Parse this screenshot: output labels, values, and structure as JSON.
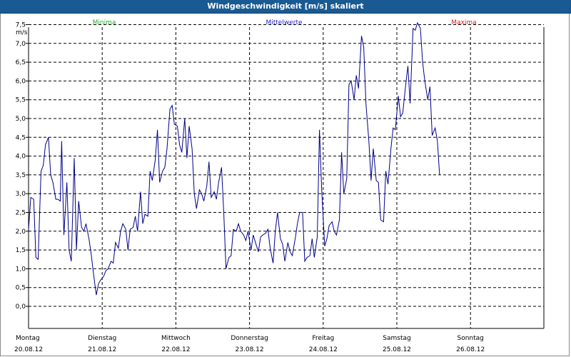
{
  "window": {
    "title": "Windgeschwindigkeit [m/s] skaliert"
  },
  "legend": {
    "min_label": "Minima",
    "min_color": "#22aa22",
    "mean_label": "Mittelwerte",
    "mean_color": "#2222cc",
    "max_label": "Maxima",
    "max_color": "#cc2222"
  },
  "chart_data": {
    "type": "line",
    "title": "Windgeschwindigkeit [m/s] skaliert",
    "ylabel": "m/s",
    "ylim": [
      0,
      7.5
    ],
    "yticks": [
      0.0,
      0.5,
      1.0,
      1.5,
      2.0,
      2.5,
      3.0,
      3.5,
      4.0,
      4.5,
      5.0,
      5.5,
      6.0,
      6.5,
      7.0,
      7.5
    ],
    "ytick_labels": [
      "0,0",
      "0,5",
      "1,0",
      "1,5",
      "2,0",
      "2,5",
      "3,0",
      "3,5",
      "4,0",
      "4,5",
      "5,0",
      "5,5",
      "6,0",
      "6,5",
      "7,0",
      "7,5"
    ],
    "xlim": [
      0,
      7
    ],
    "x_unit": "days",
    "x_ticks": [
      {
        "day": "Montag",
        "date": "20.08.12"
      },
      {
        "day": "Dienstag",
        "date": "21.08.12"
      },
      {
        "day": "Mittwoch",
        "date": "22.08.12"
      },
      {
        "day": "Donnerstag",
        "date": "23.08.12"
      },
      {
        "day": "Freitag",
        "date": "24.08.12"
      },
      {
        "day": "Samstag",
        "date": "25.08.12"
      },
      {
        "day": "Sonntag",
        "date": "26.08.12"
      }
    ],
    "grid": true,
    "series": [
      {
        "name": "Mittelwerte",
        "color": "#00008b",
        "points": [
          [
            0.0,
            2.05
          ],
          [
            0.03,
            2.9
          ],
          [
            0.07,
            2.85
          ],
          [
            0.1,
            1.3
          ],
          [
            0.13,
            1.25
          ],
          [
            0.17,
            3.6
          ],
          [
            0.2,
            3.75
          ],
          [
            0.23,
            4.3
          ],
          [
            0.27,
            4.5
          ],
          [
            0.3,
            3.5
          ],
          [
            0.33,
            3.3
          ],
          [
            0.37,
            2.85
          ],
          [
            0.4,
            2.85
          ],
          [
            0.43,
            2.8
          ],
          [
            0.45,
            4.4
          ],
          [
            0.48,
            1.9
          ],
          [
            0.52,
            3.3
          ],
          [
            0.55,
            1.5
          ],
          [
            0.58,
            1.2
          ],
          [
            0.62,
            3.95
          ],
          [
            0.65,
            1.5
          ],
          [
            0.68,
            2.8
          ],
          [
            0.72,
            2.1
          ],
          [
            0.75,
            2.0
          ],
          [
            0.78,
            2.2
          ],
          [
            0.82,
            1.8
          ],
          [
            0.85,
            1.4
          ],
          [
            0.88,
            0.9
          ],
          [
            0.92,
            0.3
          ],
          [
            0.95,
            0.6
          ],
          [
            0.98,
            0.7
          ],
          [
            1.02,
            0.8
          ],
          [
            1.05,
            0.95
          ],
          [
            1.08,
            1.0
          ],
          [
            1.12,
            1.2
          ],
          [
            1.15,
            1.15
          ],
          [
            1.18,
            1.7
          ],
          [
            1.22,
            1.55
          ],
          [
            1.25,
            2.0
          ],
          [
            1.28,
            2.2
          ],
          [
            1.32,
            2.05
          ],
          [
            1.35,
            1.5
          ],
          [
            1.38,
            2.05
          ],
          [
            1.42,
            2.1
          ],
          [
            1.45,
            2.4
          ],
          [
            1.48,
            2.0
          ],
          [
            1.52,
            3.05
          ],
          [
            1.55,
            2.2
          ],
          [
            1.58,
            2.45
          ],
          [
            1.62,
            2.4
          ],
          [
            1.65,
            3.6
          ],
          [
            1.68,
            3.35
          ],
          [
            1.72,
            3.9
          ],
          [
            1.75,
            4.7
          ],
          [
            1.78,
            3.3
          ],
          [
            1.82,
            3.6
          ],
          [
            1.85,
            3.7
          ],
          [
            1.88,
            4.2
          ],
          [
            1.92,
            5.25
          ],
          [
            1.95,
            5.35
          ],
          [
            1.98,
            4.85
          ],
          [
            2.02,
            4.8
          ],
          [
            2.05,
            4.3
          ],
          [
            2.08,
            4.1
          ],
          [
            2.12,
            5.0
          ],
          [
            2.15,
            3.95
          ],
          [
            2.18,
            4.8
          ],
          [
            2.22,
            4.2
          ],
          [
            2.25,
            3.0
          ],
          [
            2.28,
            2.6
          ],
          [
            2.32,
            3.1
          ],
          [
            2.35,
            3.0
          ],
          [
            2.38,
            2.8
          ],
          [
            2.42,
            3.2
          ],
          [
            2.45,
            3.85
          ],
          [
            2.48,
            2.9
          ],
          [
            2.52,
            3.05
          ],
          [
            2.55,
            2.85
          ],
          [
            2.58,
            3.3
          ],
          [
            2.62,
            3.7
          ],
          [
            2.65,
            2.5
          ],
          [
            2.68,
            1.0
          ],
          [
            2.72,
            1.3
          ],
          [
            2.75,
            1.35
          ],
          [
            2.78,
            2.05
          ],
          [
            2.82,
            2.0
          ],
          [
            2.85,
            2.2
          ],
          [
            2.88,
            2.0
          ],
          [
            2.92,
            1.9
          ],
          [
            2.95,
            1.75
          ],
          [
            2.98,
            2.0
          ],
          [
            3.02,
            1.5
          ],
          [
            3.05,
            1.9
          ],
          [
            3.08,
            1.7
          ],
          [
            3.12,
            1.45
          ],
          [
            3.15,
            1.85
          ],
          [
            3.18,
            1.9
          ],
          [
            3.22,
            1.95
          ],
          [
            3.25,
            2.05
          ],
          [
            3.28,
            1.55
          ],
          [
            3.32,
            1.15
          ],
          [
            3.35,
            2.0
          ],
          [
            3.38,
            2.5
          ],
          [
            3.42,
            1.8
          ],
          [
            3.45,
            1.65
          ],
          [
            3.48,
            1.2
          ],
          [
            3.52,
            1.7
          ],
          [
            3.55,
            1.45
          ],
          [
            3.58,
            1.35
          ],
          [
            3.62,
            1.8
          ],
          [
            3.65,
            2.2
          ],
          [
            3.68,
            2.5
          ],
          [
            3.72,
            2.5
          ],
          [
            3.75,
            1.2
          ],
          [
            3.78,
            1.3
          ],
          [
            3.82,
            1.35
          ],
          [
            3.85,
            1.8
          ],
          [
            3.88,
            1.3
          ],
          [
            3.92,
            1.85
          ],
          [
            3.95,
            4.7
          ],
          [
            3.98,
            3.1
          ],
          [
            4.02,
            1.6
          ],
          [
            4.05,
            1.8
          ],
          [
            4.08,
            2.15
          ],
          [
            4.12,
            2.25
          ],
          [
            4.15,
            2.0
          ],
          [
            4.18,
            1.9
          ],
          [
            4.22,
            2.3
          ],
          [
            4.25,
            4.1
          ],
          [
            4.28,
            3.0
          ],
          [
            4.32,
            3.4
          ],
          [
            4.35,
            5.9
          ],
          [
            4.38,
            6.0
          ],
          [
            4.42,
            5.5
          ],
          [
            4.45,
            6.15
          ],
          [
            4.48,
            5.8
          ],
          [
            4.52,
            7.2
          ],
          [
            4.55,
            6.9
          ],
          [
            4.58,
            5.4
          ],
          [
            4.62,
            4.4
          ],
          [
            4.65,
            3.35
          ],
          [
            4.68,
            4.2
          ],
          [
            4.72,
            3.35
          ],
          [
            4.75,
            3.3
          ],
          [
            4.78,
            2.3
          ],
          [
            4.82,
            2.25
          ],
          [
            4.85,
            3.6
          ],
          [
            4.88,
            3.25
          ],
          [
            4.92,
            4.2
          ],
          [
            4.95,
            4.75
          ],
          [
            4.98,
            4.7
          ],
          [
            5.02,
            5.6
          ],
          [
            5.05,
            5.05
          ],
          [
            5.08,
            5.15
          ],
          [
            5.12,
            5.9
          ],
          [
            5.15,
            6.4
          ],
          [
            5.18,
            5.4
          ],
          [
            5.22,
            7.4
          ],
          [
            5.25,
            7.35
          ],
          [
            5.28,
            7.55
          ],
          [
            5.32,
            7.4
          ],
          [
            5.35,
            6.5
          ],
          [
            5.38,
            6.0
          ],
          [
            5.42,
            5.5
          ],
          [
            5.45,
            5.85
          ],
          [
            5.48,
            4.55
          ],
          [
            5.52,
            4.75
          ],
          [
            5.55,
            4.4
          ],
          [
            5.58,
            3.5
          ]
        ]
      }
    ]
  }
}
